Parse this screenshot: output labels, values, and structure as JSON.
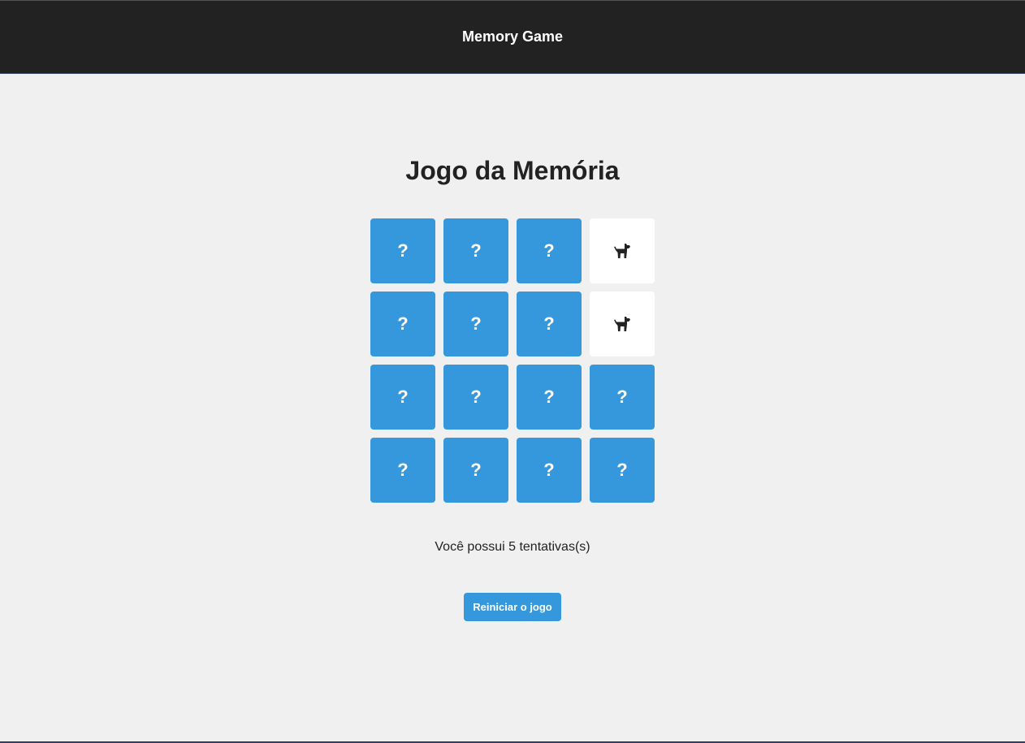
{
  "header": {
    "title": "Memory Game"
  },
  "game": {
    "title": "Jogo da Memória",
    "cards": [
      {
        "state": "hidden",
        "label": "?"
      },
      {
        "state": "hidden",
        "label": "?"
      },
      {
        "state": "hidden",
        "label": "?"
      },
      {
        "state": "revealed",
        "icon": "dog-icon"
      },
      {
        "state": "hidden",
        "label": "?"
      },
      {
        "state": "hidden",
        "label": "?"
      },
      {
        "state": "hidden",
        "label": "?"
      },
      {
        "state": "revealed",
        "icon": "dog-icon"
      },
      {
        "state": "hidden",
        "label": "?"
      },
      {
        "state": "hidden",
        "label": "?"
      },
      {
        "state": "hidden",
        "label": "?"
      },
      {
        "state": "hidden",
        "label": "?"
      },
      {
        "state": "hidden",
        "label": "?"
      },
      {
        "state": "hidden",
        "label": "?"
      },
      {
        "state": "hidden",
        "label": "?"
      },
      {
        "state": "hidden",
        "label": "?"
      }
    ],
    "attempts_text": "Você possui 5 tentativas(s)",
    "restart_label": "Reiniciar o jogo"
  },
  "colors": {
    "card_back": "#3598dc",
    "card_revealed": "#ffffff",
    "header_bg": "#222222",
    "page_bg": "#f0f0f0"
  }
}
